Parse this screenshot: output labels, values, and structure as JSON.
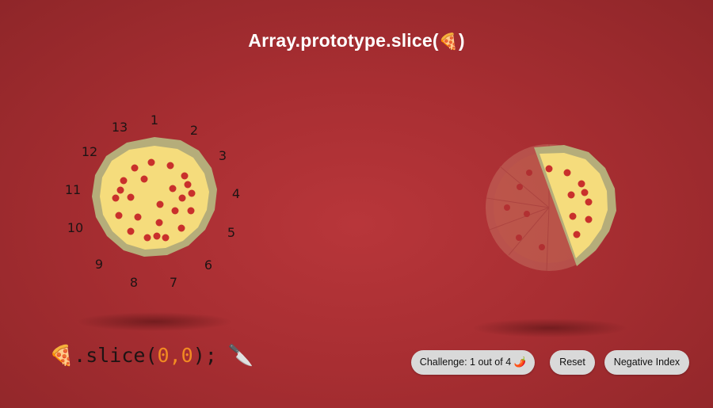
{
  "header": {
    "title_prefix": "Array.prototype.slice(",
    "title_emoji": "🍕",
    "title_suffix": ")"
  },
  "dial": {
    "numbers": [
      "1",
      "2",
      "3",
      "4",
      "5",
      "6",
      "7",
      "8",
      "9",
      "10",
      "11",
      "12",
      "13"
    ]
  },
  "code": {
    "emoji": "🍕",
    "method": ".slice(",
    "start": "0",
    "comma": ",",
    "end": "0",
    "close": ");",
    "knife": "🔪"
  },
  "controls": {
    "challenge_label": "Challenge: 1 out of 4 🌶️",
    "reset_label": "Reset",
    "negative_label": "Negative Index"
  },
  "colors": {
    "background": "#a82e32",
    "crust": "#b5ad7a",
    "cheese": "#f5dc7c",
    "pepperoni": "#c9302c",
    "accent_code": "#f28b22",
    "button": "#d9d9d9"
  }
}
